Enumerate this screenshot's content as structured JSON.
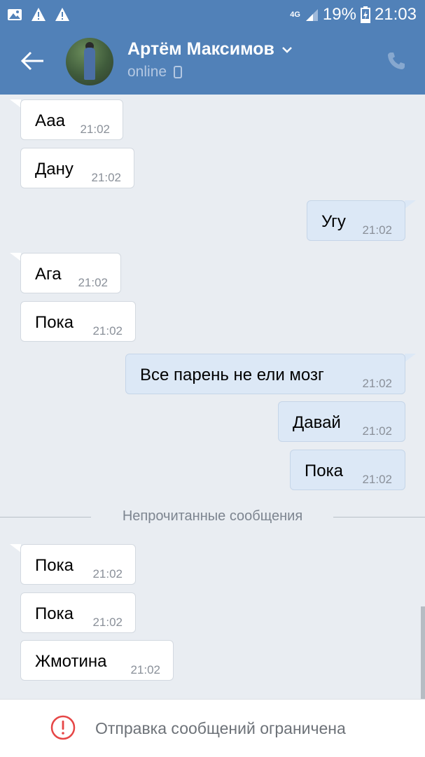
{
  "status_bar": {
    "network": "4G",
    "battery": "19%",
    "time": "21:03"
  },
  "header": {
    "contact_name": "Артём Максимов",
    "status": "online"
  },
  "messages": [
    {
      "direction": "in",
      "text": "Ааа",
      "time": "21:02"
    },
    {
      "direction": "in",
      "text": "Дану",
      "time": "21:02"
    },
    {
      "direction": "out",
      "text": "Угу",
      "time": "21:02"
    },
    {
      "direction": "in",
      "text": "Ага",
      "time": "21:02"
    },
    {
      "direction": "in",
      "text": "Пока",
      "time": "21:02"
    },
    {
      "direction": "out",
      "text": "Все парень не ели мозг",
      "time": "21:02"
    },
    {
      "direction": "out",
      "text": "Давай",
      "time": "21:02"
    },
    {
      "direction": "out",
      "text": "Пока",
      "time": "21:02"
    },
    {
      "direction": "in",
      "text": "Пока",
      "time": "21:02"
    },
    {
      "direction": "in",
      "text": "Пока",
      "time": "21:02"
    },
    {
      "direction": "in",
      "text": "Жмотина",
      "time": "21:02"
    }
  ],
  "unread_divider": "Непрочитанные сообщения",
  "footer": {
    "notice": "Отправка сообщений ограничена"
  },
  "colors": {
    "header_bg": "#5181b8",
    "chat_bg": "#e9edf2",
    "outgoing_bubble": "#dce8f6",
    "warning": "#e64646"
  }
}
